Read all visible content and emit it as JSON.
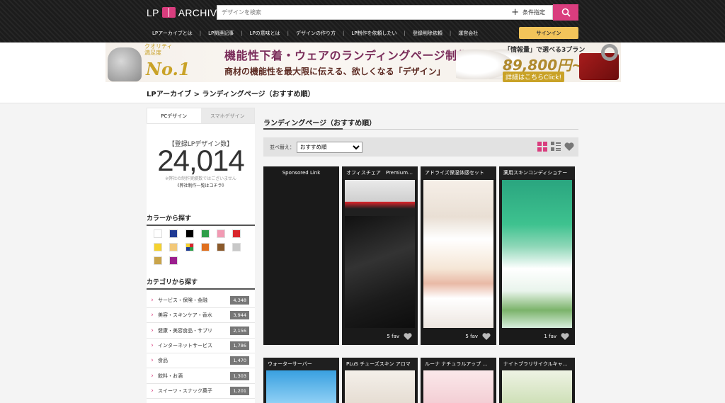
{
  "header": {
    "logo_left": "LP",
    "logo_right": "ARCHIVE",
    "search_placeholder": "デザインを検索",
    "condition_label": "条件指定",
    "nav": [
      "LPアーカイブとは",
      "LP関連記事",
      "LPの意味とは",
      "デザインの作り方",
      "LP制作を依頼したい",
      "登録削除依頼",
      "運営会社"
    ],
    "signin": "サインイン"
  },
  "banner": {
    "badge_line1": "クオリティ",
    "badge_line2": "満足度",
    "badge_no1": "No.1",
    "headline": "機能性下着・ウェアのランディングページ制作",
    "subline": "商材の機能性を最大限に伝える、欲しくなる「デザイン」",
    "price_label": "「情報量」で選べる3プラン",
    "price": "89,800円~",
    "cta": "詳細はこちらClick!"
  },
  "breadcrumb": "LPアーカイブ > ランディングページ（おすすめ順）",
  "sidebar": {
    "tabs": [
      "PCデザイン",
      "スマホデザイン"
    ],
    "count_label": "【登録LPデザイン数】",
    "count": "24,014",
    "count_note": "※弊社の制作実績数ではございません",
    "count_link": "《弊社制作一覧はコチラ》",
    "color_title": "カラーから探す",
    "colors": [
      "#ffffff",
      "#1f3a93",
      "#000000",
      "#2e9e49",
      "#f29ab3",
      "#d9262c",
      "#f5d22f",
      "#f2c879",
      "multi",
      "#e0701f",
      "#8b5a2b",
      "#c8c8c8",
      "#c9a44a",
      "#9b1f8e"
    ],
    "category_title": "カテゴリから探す",
    "categories": [
      {
        "name": "サービス・保険・金融",
        "count": "4,348"
      },
      {
        "name": "美容・スキンケア・香水",
        "count": "3,944"
      },
      {
        "name": "健康・美容食品・サプリ",
        "count": "2,156"
      },
      {
        "name": "インターネットサービス",
        "count": "1,786"
      },
      {
        "name": "食品",
        "count": "1,470"
      },
      {
        "name": "飲料・お酒",
        "count": "1,303"
      },
      {
        "name": "スイーツ・スナック菓子",
        "count": "1,201"
      }
    ]
  },
  "main": {
    "title": "ランディングページ（おすすめ順）",
    "sort_label": "並べ替え：",
    "sort_selected": "おすすめ順",
    "cards": [
      {
        "title": "Sponsored Link",
        "fav": ""
      },
      {
        "title": "オフィスチェア　Premium Mesh",
        "fav": "5 fav"
      },
      {
        "title": "アドライズ保湿体感セット",
        "fav": "5 fav"
      },
      {
        "title": "薬用スキンコンディショナー",
        "fav": "1 fav"
      },
      {
        "title": "ウォーターサーバー",
        "fav": ""
      },
      {
        "title": "PLuS チューズスキン アロマ",
        "fav": ""
      },
      {
        "title": "ルーナ ナチュラルアップ クリーム",
        "fav": ""
      },
      {
        "title": "ナイトブラリサイクルキャンペーン",
        "fav": ""
      }
    ]
  }
}
